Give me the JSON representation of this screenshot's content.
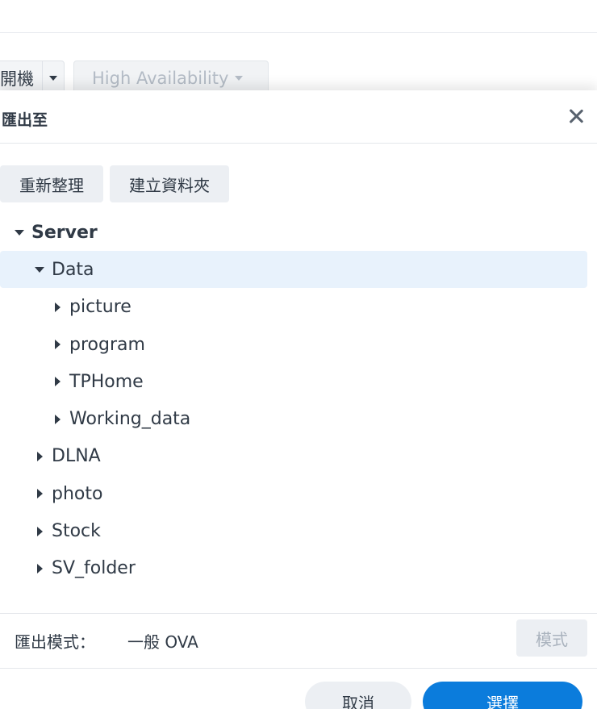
{
  "background": {
    "split_button_label": "開機",
    "ha_button_label": "High Availability"
  },
  "dialog": {
    "title": "匯出至",
    "toolbar": {
      "refresh_label": "重新整理",
      "new_folder_label": "建立資料夾"
    },
    "tree": [
      {
        "label": "Server",
        "level": 0,
        "expanded": true,
        "selected": false
      },
      {
        "label": "Data",
        "level": 1,
        "expanded": true,
        "selected": true
      },
      {
        "label": "picture",
        "level": 2,
        "expanded": false,
        "selected": false
      },
      {
        "label": "program",
        "level": 2,
        "expanded": false,
        "selected": false
      },
      {
        "label": "TPHome",
        "level": 2,
        "expanded": false,
        "selected": false
      },
      {
        "label": "Working_data",
        "level": 2,
        "expanded": false,
        "selected": false
      },
      {
        "label": "DLNA",
        "level": 1,
        "expanded": false,
        "selected": false
      },
      {
        "label": "photo",
        "level": 1,
        "expanded": false,
        "selected": false
      },
      {
        "label": "Stock",
        "level": 1,
        "expanded": false,
        "selected": false
      },
      {
        "label": "SV_folder",
        "level": 1,
        "expanded": false,
        "selected": false
      }
    ],
    "export_mode": {
      "label": "匯出模式：",
      "value": "一般 OVA",
      "button_label": "模式"
    },
    "cancel_label": "取消",
    "ok_label": "選擇"
  },
  "colors": {
    "primary": "#0b7cdc",
    "selected_row": "#e8f2fc",
    "button_bg": "#eceff3",
    "text": "#303a46"
  },
  "icons": {
    "close": "close-icon",
    "expanded": "caret-down-icon",
    "collapsed": "caret-right-icon"
  }
}
